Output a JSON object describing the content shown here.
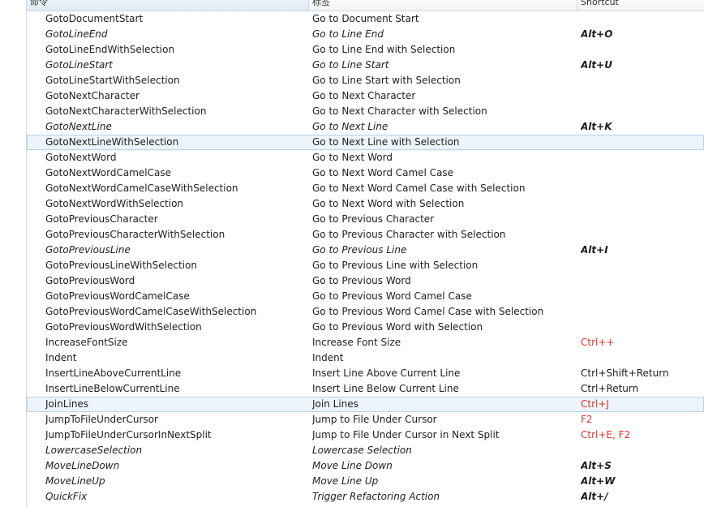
{
  "header": {
    "col_command": "命令",
    "col_label": "标签",
    "col_shortcut": "Shortcut"
  },
  "rows": [
    {
      "command": "GotoDocumentStart",
      "label": "Go to Document Start",
      "shortcut": "",
      "italic": false,
      "style": "",
      "selected": false
    },
    {
      "command": "GotoLineEnd",
      "label": "Go to Line End",
      "shortcut": "Alt+O",
      "italic": true,
      "style": "bold",
      "selected": false
    },
    {
      "command": "GotoLineEndWithSelection",
      "label": "Go to Line End with Selection",
      "shortcut": "",
      "italic": false,
      "style": "",
      "selected": false
    },
    {
      "command": "GotoLineStart",
      "label": "Go to Line Start",
      "shortcut": "Alt+U",
      "italic": true,
      "style": "bold",
      "selected": false
    },
    {
      "command": "GotoLineStartWithSelection",
      "label": "Go to Line Start with Selection",
      "shortcut": "",
      "italic": false,
      "style": "",
      "selected": false
    },
    {
      "command": "GotoNextCharacter",
      "label": "Go to Next Character",
      "shortcut": "",
      "italic": false,
      "style": "",
      "selected": false
    },
    {
      "command": "GotoNextCharacterWithSelection",
      "label": "Go to Next Character with Selection",
      "shortcut": "",
      "italic": false,
      "style": "",
      "selected": false
    },
    {
      "command": "GotoNextLine",
      "label": "Go to Next Line",
      "shortcut": "Alt+K",
      "italic": true,
      "style": "bold",
      "selected": false
    },
    {
      "command": "GotoNextLineWithSelection",
      "label": "Go to Next Line with Selection",
      "shortcut": "",
      "italic": false,
      "style": "",
      "selected": true
    },
    {
      "command": "GotoNextWord",
      "label": "Go to Next Word",
      "shortcut": "",
      "italic": false,
      "style": "",
      "selected": false
    },
    {
      "command": "GotoNextWordCamelCase",
      "label": "Go to Next Word Camel Case",
      "shortcut": "",
      "italic": false,
      "style": "",
      "selected": false
    },
    {
      "command": "GotoNextWordCamelCaseWithSelection",
      "label": "Go to Next Word Camel Case with Selection",
      "shortcut": "",
      "italic": false,
      "style": "",
      "selected": false
    },
    {
      "command": "GotoNextWordWithSelection",
      "label": "Go to Next Word with Selection",
      "shortcut": "",
      "italic": false,
      "style": "",
      "selected": false
    },
    {
      "command": "GotoPreviousCharacter",
      "label": "Go to Previous Character",
      "shortcut": "",
      "italic": false,
      "style": "",
      "selected": false
    },
    {
      "command": "GotoPreviousCharacterWithSelection",
      "label": "Go to Previous Character with Selection",
      "shortcut": "",
      "italic": false,
      "style": "",
      "selected": false
    },
    {
      "command": "GotoPreviousLine",
      "label": "Go to Previous Line",
      "shortcut": "Alt+I",
      "italic": true,
      "style": "bold",
      "selected": false
    },
    {
      "command": "GotoPreviousLineWithSelection",
      "label": "Go to Previous Line with Selection",
      "shortcut": "",
      "italic": false,
      "style": "",
      "selected": false
    },
    {
      "command": "GotoPreviousWord",
      "label": "Go to Previous Word",
      "shortcut": "",
      "italic": false,
      "style": "",
      "selected": false
    },
    {
      "command": "GotoPreviousWordCamelCase",
      "label": "Go to Previous Word Camel Case",
      "shortcut": "",
      "italic": false,
      "style": "",
      "selected": false
    },
    {
      "command": "GotoPreviousWordCamelCaseWithSelection",
      "label": "Go to Previous Word Camel Case with Selection",
      "shortcut": "",
      "italic": false,
      "style": "",
      "selected": false
    },
    {
      "command": "GotoPreviousWordWithSelection",
      "label": "Go to Previous Word with Selection",
      "shortcut": "",
      "italic": false,
      "style": "",
      "selected": false
    },
    {
      "command": "IncreaseFontSize",
      "label": "Increase Font Size",
      "shortcut": "Ctrl++",
      "italic": false,
      "style": "red",
      "selected": false
    },
    {
      "command": "Indent",
      "label": "Indent",
      "shortcut": "",
      "italic": false,
      "style": "",
      "selected": false
    },
    {
      "command": "InsertLineAboveCurrentLine",
      "label": "Insert Line Above Current Line",
      "shortcut": "Ctrl+Shift+Return",
      "italic": false,
      "style": "",
      "selected": false
    },
    {
      "command": "InsertLineBelowCurrentLine",
      "label": "Insert Line Below Current Line",
      "shortcut": "Ctrl+Return",
      "italic": false,
      "style": "",
      "selected": false
    },
    {
      "command": "JoinLines",
      "label": "Join Lines",
      "shortcut": "Ctrl+J",
      "italic": false,
      "style": "red",
      "selected": true
    },
    {
      "command": "JumpToFileUnderCursor",
      "label": "Jump to File Under Cursor",
      "shortcut": "F2",
      "italic": false,
      "style": "red",
      "selected": false
    },
    {
      "command": "JumpToFileUnderCursorInNextSplit",
      "label": "Jump to File Under Cursor in Next Split",
      "shortcut": "Ctrl+E, F2",
      "italic": false,
      "style": "red",
      "selected": false
    },
    {
      "command": "LowercaseSelection",
      "label": "Lowercase Selection",
      "shortcut": "",
      "italic": true,
      "style": "",
      "selected": false
    },
    {
      "command": "MoveLineDown",
      "label": "Move Line Down",
      "shortcut": "Alt+S",
      "italic": true,
      "style": "bold",
      "selected": false
    },
    {
      "command": "MoveLineUp",
      "label": "Move Line Up",
      "shortcut": "Alt+W",
      "italic": true,
      "style": "bold",
      "selected": false
    },
    {
      "command": "QuickFix",
      "label": "Trigger Refactoring Action",
      "shortcut": "Alt+/",
      "italic": true,
      "style": "bold",
      "selected": false
    }
  ]
}
